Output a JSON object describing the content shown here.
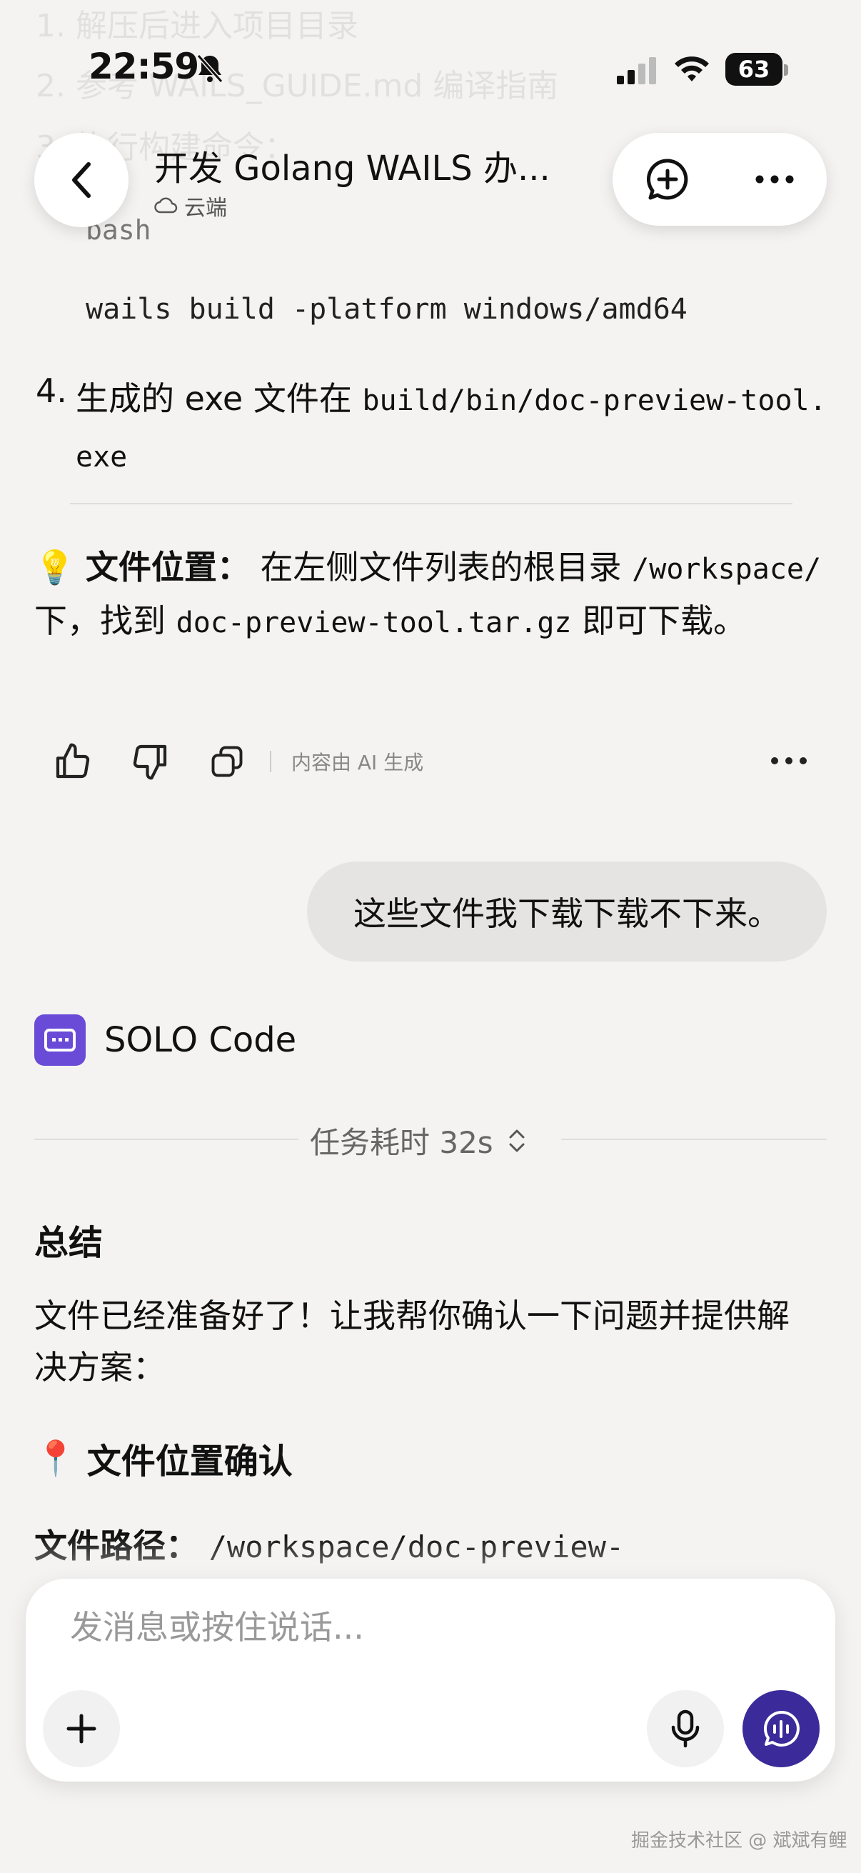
{
  "ghost": {
    "line1": "1. 解压后进入项目目录",
    "line2": "2. 参考 WAILS_GUIDE.md 编译指南",
    "line3": "3. 执行构建命令："
  },
  "status_bar": {
    "time": "22:59",
    "battery": "63"
  },
  "header": {
    "title": "开发 Golang WAILS 办...",
    "subtitle": "云端"
  },
  "content": {
    "code_lang": "bash",
    "code_line": "wails build -platform windows/amd64",
    "step4": {
      "number": "4.",
      "text": "生成的 exe 文件在 ",
      "path": "build/bin/doc-preview-tool.exe"
    },
    "tip": {
      "emoji": "💡",
      "label": "文件位置：",
      "text1": " 在左侧文件列表的根目录 ",
      "root": "/workspace/",
      "text2": " 下，找到 ",
      "file": "doc-preview-tool.tar.gz",
      "text3": " 即可下载。"
    },
    "ai_note": "内容由 AI 生成"
  },
  "user_message": "这些文件我下载下载不下来。",
  "assistant": {
    "name": "SOLO Code",
    "duration": "任务耗时 32s",
    "summary_heading": "总结",
    "summary_text": "文件已经准备好了！让我帮你确认一下问题并提供解决方案：",
    "location_emoji": "📍",
    "location_heading": "文件位置确认",
    "path_label": "文件路径：",
    "path_value": "/workspace/doc-preview-"
  },
  "composer": {
    "placeholder": "发消息或按住说话..."
  },
  "watermark": "掘金技术社区 @ 斌斌有鲤",
  "colors": {
    "background": "#f4f3f2",
    "accent": "#3a2a9a",
    "logo": "#6a4bd8"
  }
}
